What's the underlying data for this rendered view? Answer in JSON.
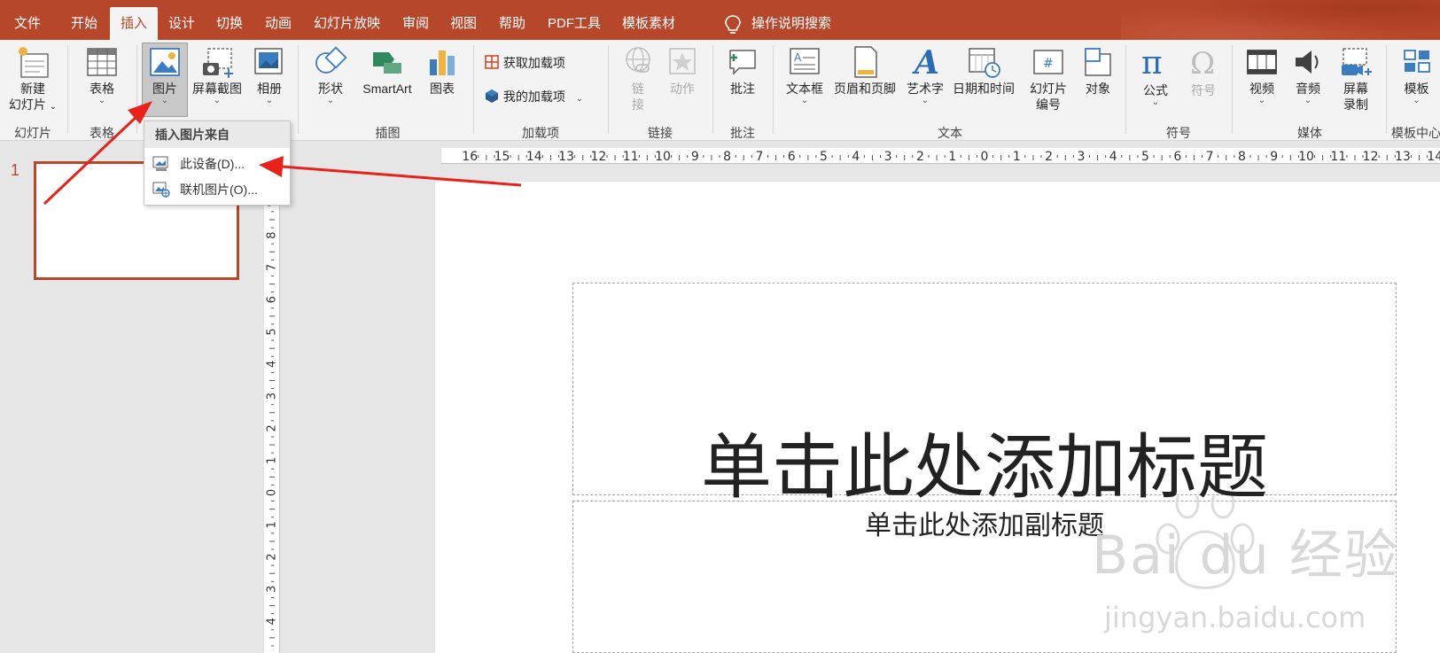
{
  "menu": {
    "tabs": [
      {
        "label": "文件"
      },
      {
        "label": "开始"
      },
      {
        "label": "插入"
      },
      {
        "label": "设计"
      },
      {
        "label": "切换"
      },
      {
        "label": "动画"
      },
      {
        "label": "幻灯片放映"
      },
      {
        "label": "审阅"
      },
      {
        "label": "视图"
      },
      {
        "label": "帮助"
      },
      {
        "label": "PDF工具"
      },
      {
        "label": "模板素材"
      }
    ],
    "active_tab": "插入",
    "tell_me": "操作说明搜索"
  },
  "ribbon": {
    "groups": {
      "slides": "幻灯片",
      "tables": "表格",
      "illustrations": "插图",
      "addins": "加载项",
      "links": "链接",
      "comments": "批注",
      "text": "文本",
      "symbols": "符号",
      "media": "媒体",
      "template_center": "模板中心"
    },
    "buttons": {
      "new_slide_l1": "新建",
      "new_slide_l2": "幻灯片",
      "table": "表格",
      "pictures": "图片",
      "screenshot": "屏幕截图",
      "album": "相册",
      "shapes": "形状",
      "smartart": "SmartArt",
      "chart": "图表",
      "get_addins": "获取加载项",
      "my_addins": "我的加载项",
      "link_l1": "链",
      "link_l2": "接",
      "action": "动作",
      "comment": "批注",
      "textbox": "文本框",
      "header_footer": "页眉和页脚",
      "wordart": "艺术字",
      "datetime": "日期和时间",
      "slide_number_l1": "幻灯片",
      "slide_number_l2": "编号",
      "object": "对象",
      "equation": "公式",
      "symbol": "符号",
      "video": "视频",
      "audio": "音频",
      "screen_recording_l1": "屏幕",
      "screen_recording_l2": "录制",
      "template": "模板"
    },
    "chevron": "⌄"
  },
  "dropdown": {
    "header": "插入图片来自",
    "items": [
      {
        "label": "此设备(D)..."
      },
      {
        "label": "联机图片(O)..."
      }
    ]
  },
  "slides_panel": {
    "slide_number": "1"
  },
  "slide": {
    "title_placeholder": "单击此处添加标题",
    "subtitle_placeholder": "单击此处添加副标题"
  },
  "watermark": {
    "logo": "Bai du 经验",
    "url": "jingyan.baidu.com"
  },
  "colors": {
    "accent": "#b7472a",
    "ribbon_bg": "#f3f3f3",
    "arrow": "#e8221b"
  }
}
